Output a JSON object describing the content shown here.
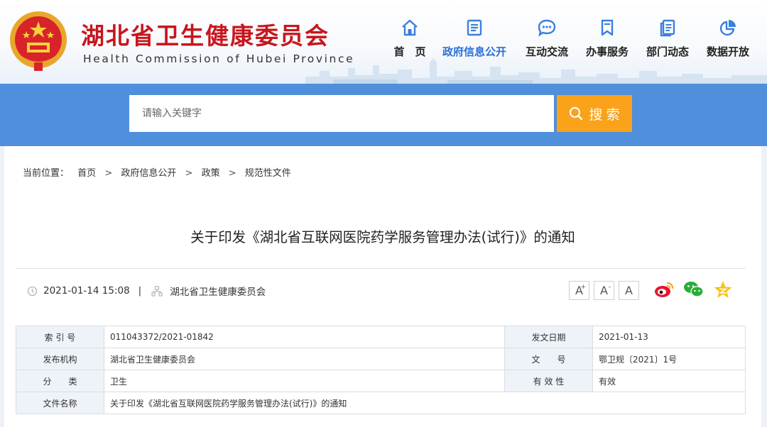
{
  "site": {
    "title": "湖北省卫生健康委员会",
    "subtitle": "Health Commission of Hubei Province"
  },
  "nav": [
    {
      "label": "首　页",
      "icon": "home-icon",
      "active": false
    },
    {
      "label": "政府信息公开",
      "icon": "document-icon",
      "active": true
    },
    {
      "label": "互动交流",
      "icon": "chat-icon",
      "active": false
    },
    {
      "label": "办事服务",
      "icon": "bookmark-icon",
      "active": false
    },
    {
      "label": "部门动态",
      "icon": "news-icon",
      "active": false
    },
    {
      "label": "数据开放",
      "icon": "pie-chart-icon",
      "active": false
    }
  ],
  "search": {
    "placeholder": "请输入关键字",
    "button_label": "搜 索"
  },
  "breadcrumb": {
    "prefix": "当前位置：",
    "items": [
      "首页",
      "政府信息公开",
      "政策",
      "规范性文件"
    ]
  },
  "article": {
    "title": "关于印发《湖北省互联网医院药学服务管理办法(试行)》的通知",
    "datetime": "2021-01-14 15:08",
    "separator": "|",
    "publisher": "湖北省卫生健康委员会"
  },
  "font_controls": [
    {
      "label": "A",
      "sup": "+"
    },
    {
      "label": "A",
      "sup": "-"
    },
    {
      "label": "A",
      "sup": ""
    }
  ],
  "share_icons": [
    "weibo-icon",
    "wechat-icon",
    "qzone-icon"
  ],
  "info_table": {
    "rows": [
      {
        "l1": "索 引 号",
        "v1": "011043372/2021-01842",
        "l2": "发文日期",
        "v2": "2021-01-13"
      },
      {
        "l1": "发布机构",
        "v1": "湖北省卫生健康委员会",
        "l2": "文　　号",
        "v2": "鄂卫规〔2021〕1号"
      },
      {
        "l1": "分　　类",
        "v1": "卫生",
        "l2": "有 效 性",
        "v2": "有效"
      },
      {
        "l1": "文件名称",
        "v1": "关于印发《湖北省互联网医院药学服务管理办法(试行)》的通知",
        "l2": "",
        "v2": ""
      }
    ]
  },
  "colors": {
    "brand_red": "#c7161d",
    "nav_active": "#2b6fd6",
    "search_band": "#4f8fdc",
    "search_button": "#f9a21a",
    "icon_blue": "#3a7fe0"
  }
}
